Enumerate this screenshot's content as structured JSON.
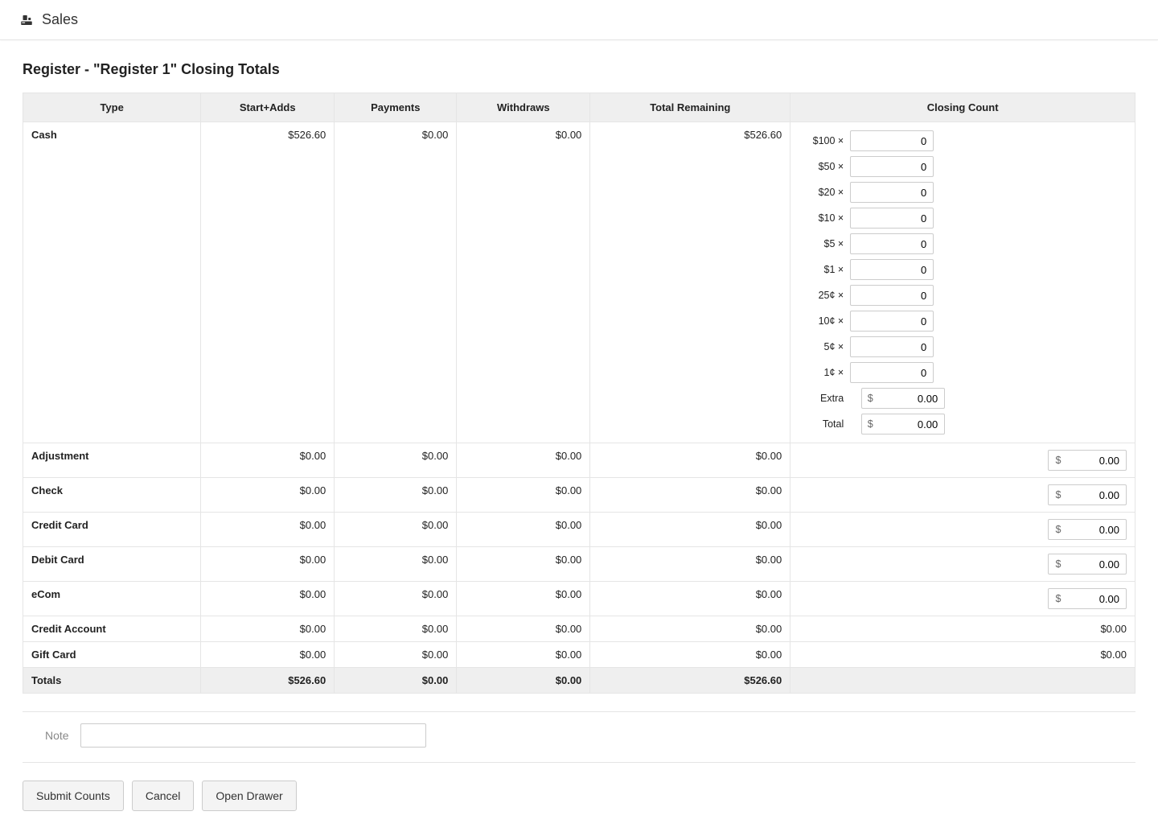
{
  "header": {
    "title": "Sales"
  },
  "page": {
    "title": "Register - \"Register 1\" Closing Totals"
  },
  "columns": {
    "type": "Type",
    "start_adds": "Start+Adds",
    "payments": "Payments",
    "withdraws": "Withdraws",
    "total_remaining": "Total Remaining",
    "closing_count": "Closing Count"
  },
  "rows": [
    {
      "type": "Cash",
      "start_adds": "$526.60",
      "payments": "$0.00",
      "withdraws": "$0.00",
      "total_remaining": "$526.60",
      "closing_kind": "denoms"
    },
    {
      "type": "Adjustment",
      "start_adds": "$0.00",
      "payments": "$0.00",
      "withdraws": "$0.00",
      "total_remaining": "$0.00",
      "closing_kind": "money_input",
      "closing_value": "0.00"
    },
    {
      "type": "Check",
      "start_adds": "$0.00",
      "payments": "$0.00",
      "withdraws": "$0.00",
      "total_remaining": "$0.00",
      "closing_kind": "money_input",
      "closing_value": "0.00"
    },
    {
      "type": "Credit Card",
      "start_adds": "$0.00",
      "payments": "$0.00",
      "withdraws": "$0.00",
      "total_remaining": "$0.00",
      "closing_kind": "money_input",
      "closing_value": "0.00"
    },
    {
      "type": "Debit Card",
      "start_adds": "$0.00",
      "payments": "$0.00",
      "withdraws": "$0.00",
      "total_remaining": "$0.00",
      "closing_kind": "money_input",
      "closing_value": "0.00"
    },
    {
      "type": "eCom",
      "start_adds": "$0.00",
      "payments": "$0.00",
      "withdraws": "$0.00",
      "total_remaining": "$0.00",
      "closing_kind": "money_input",
      "closing_value": "0.00"
    },
    {
      "type": "Credit Account",
      "start_adds": "$0.00",
      "payments": "$0.00",
      "withdraws": "$0.00",
      "total_remaining": "$0.00",
      "closing_kind": "text",
      "closing_text": "$0.00"
    },
    {
      "type": "Gift Card",
      "start_adds": "$0.00",
      "payments": "$0.00",
      "withdraws": "$0.00",
      "total_remaining": "$0.00",
      "closing_kind": "text",
      "closing_text": "$0.00"
    }
  ],
  "denoms": [
    {
      "label": "$100 ×",
      "value": "0"
    },
    {
      "label": "$50 ×",
      "value": "0"
    },
    {
      "label": "$20 ×",
      "value": "0"
    },
    {
      "label": "$10 ×",
      "value": "0"
    },
    {
      "label": "$5 ×",
      "value": "0"
    },
    {
      "label": "$1 ×",
      "value": "0"
    },
    {
      "label": "25¢ ×",
      "value": "0"
    },
    {
      "label": "10¢ ×",
      "value": "0"
    },
    {
      "label": "5¢ ×",
      "value": "0"
    },
    {
      "label": "1¢ ×",
      "value": "0"
    }
  ],
  "denom_footer": [
    {
      "label": "Extra",
      "prefix": "$",
      "value": "0.00"
    },
    {
      "label": "Total",
      "prefix": "$",
      "value": "0.00"
    }
  ],
  "totals": {
    "label": "Totals",
    "start_adds": "$526.60",
    "payments": "$0.00",
    "withdraws": "$0.00",
    "total_remaining": "$526.60",
    "closing": ""
  },
  "note": {
    "label": "Note",
    "value": ""
  },
  "actions": {
    "submit": "Submit Counts",
    "cancel": "Cancel",
    "open_drawer": "Open Drawer"
  }
}
